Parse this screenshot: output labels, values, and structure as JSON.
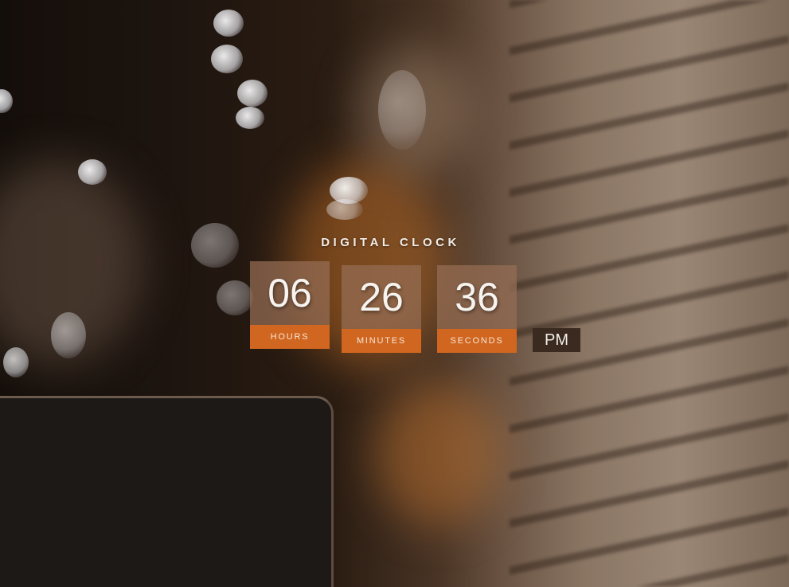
{
  "clock": {
    "title": "DIGITAL CLOCK",
    "hours": {
      "value": "06",
      "label": "HOURS"
    },
    "minutes": {
      "value": "26",
      "label": "MINUTES"
    },
    "seconds": {
      "value": "36",
      "label": "SECONDS"
    },
    "period": "PM"
  },
  "colors": {
    "label_accent": "#d0661f",
    "unit_background": "#966e55",
    "period_background": "#3a2a1f"
  }
}
